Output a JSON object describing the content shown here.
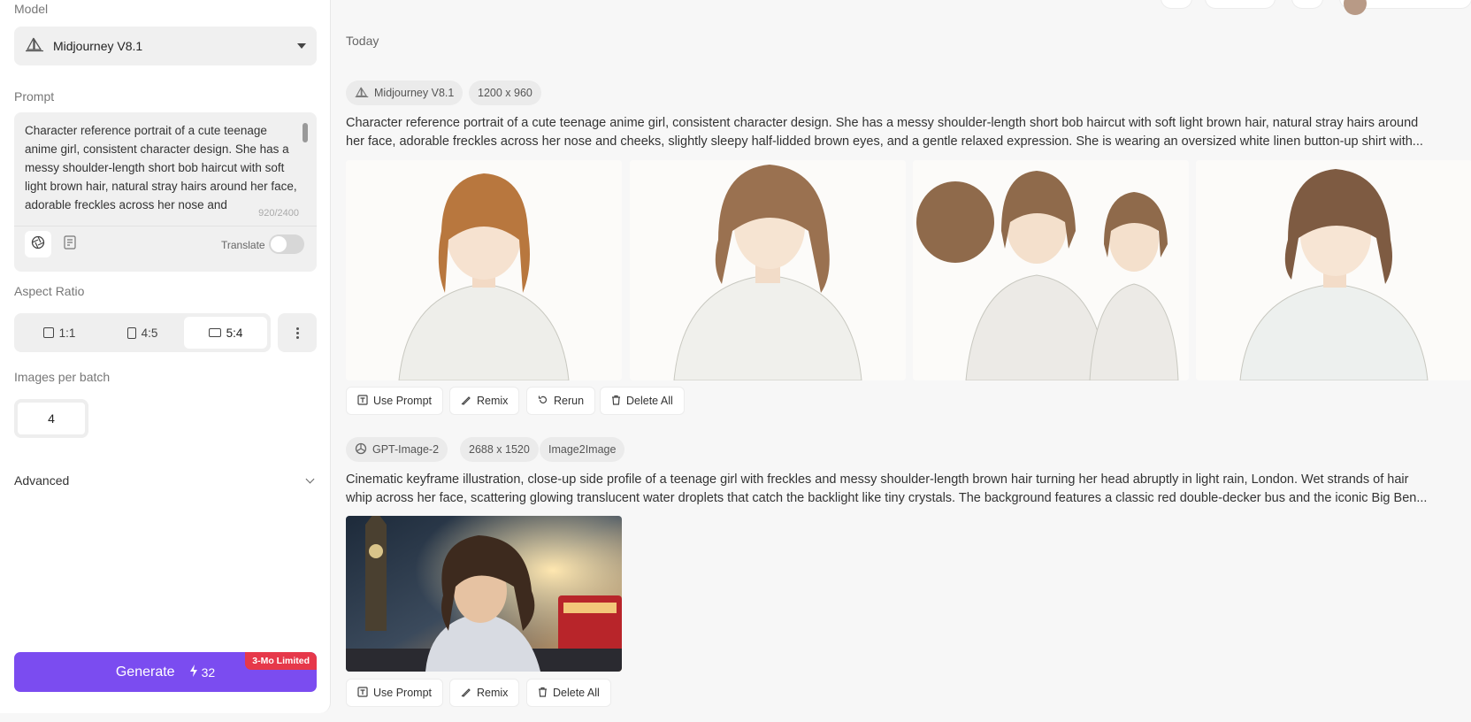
{
  "sidebar": {
    "model_label": "Model",
    "model_value": "Midjourney V8.1",
    "prompt_label": "Prompt",
    "prompt_text": "Character reference portrait of a cute teenage anime girl, consistent character design. She has a messy shoulder-length short bob haircut with soft light brown hair, natural stray hairs around her face, adorable freckles across her nose and",
    "prompt_count": "920/2400",
    "translate_label": "Translate",
    "aspect_label": "Aspect Ratio",
    "ratios": [
      {
        "label": "1:1"
      },
      {
        "label": "4:5"
      },
      {
        "label": "5:4"
      }
    ],
    "selected_ratio": "5:4",
    "batch_label": "Images per batch",
    "batch_value": "4",
    "advanced_label": "Advanced",
    "generate_label": "Generate",
    "generate_credits": "32",
    "generate_badge": "3-Mo Limited"
  },
  "main": {
    "section_title": "Today",
    "jobs": [
      {
        "tags": [
          "Midjourney V8.1",
          "1200 x 960"
        ],
        "prompt_line1": "Character reference portrait of a cute teenage anime girl, consistent character design. She has a messy shoulder-length short bob haircut with soft light brown hair, natural stray hairs around",
        "prompt_line2": "her face, adorable freckles across her nose and cheeks, slightly sleepy half-lidded brown eyes, and a gentle relaxed expression. She is wearing an oversized white linen button-up shirt with...",
        "actions": [
          "Use Prompt",
          "Remix",
          "Rerun",
          "Delete All"
        ]
      },
      {
        "tags": [
          "GPT-Image-2",
          "2688 x 1520",
          "Image2Image"
        ],
        "prompt_line1": "Cinematic keyframe illustration, close-up side profile of a teenage girl with freckles and messy shoulder-length brown hair turning her head abruptly in light rain, London. Wet strands of hair",
        "prompt_line2": "whip across her face, scattering glowing translucent water droplets that catch the backlight like tiny crystals. The background features a classic red double-decker bus and the iconic Big Ben...",
        "actions": [
          "Use Prompt",
          "Remix",
          "Delete All"
        ]
      }
    ]
  },
  "colors": {
    "accent": "#7b4cf0",
    "badge": "#e6384a"
  }
}
